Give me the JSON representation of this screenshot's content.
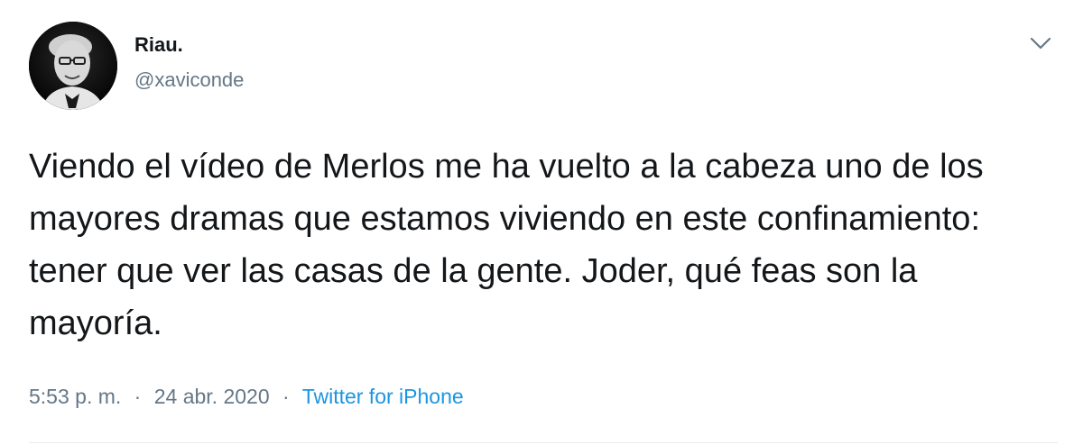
{
  "user": {
    "display_name": "Riau.",
    "handle": "@xaviconde"
  },
  "tweet": {
    "text": "Viendo el vídeo de Merlos me ha vuelto a la cabeza uno de los mayores dramas que estamos viviendo en este confinamiento: tener que ver las casas de la gente. Joder, qué feas son la mayoría.",
    "time": "5:53 p. m.",
    "separator": "·",
    "date": "24 abr. 2020",
    "source": "Twitter for iPhone"
  },
  "icons": {
    "menu": "chevron-down-icon",
    "avatar": "avatar-photo"
  },
  "colors": {
    "text": "#14171a",
    "secondary": "#657786",
    "link": "#1b95e0",
    "divider": "#e6ecf0"
  }
}
